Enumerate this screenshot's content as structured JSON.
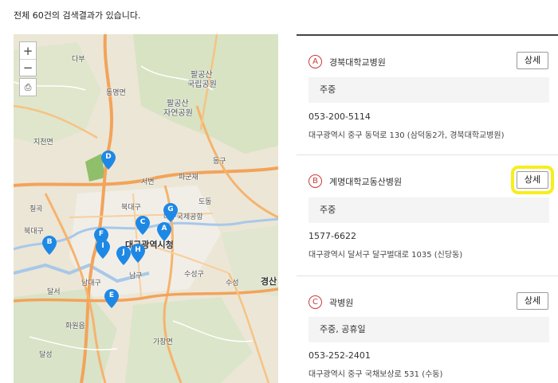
{
  "summary": "전체 60건의 검색결과가 있습니다.",
  "map": {
    "zoom_in": "+",
    "zoom_out": "−",
    "print_icon": "⎙",
    "places": [
      {
        "label": "팔공산",
        "cls": "mid"
      },
      {
        "label": "국립공원",
        "cls": "mid"
      },
      {
        "label": "팔공산",
        "cls": "mid"
      },
      {
        "label": "자연공원",
        "cls": "mid"
      },
      {
        "label": "다부",
        "cls": ""
      },
      {
        "label": "동명면",
        "cls": ""
      },
      {
        "label": "지천면",
        "cls": ""
      },
      {
        "label": "칠곡",
        "cls": ""
      },
      {
        "label": "서변",
        "cls": ""
      },
      {
        "label": "파군재",
        "cls": ""
      },
      {
        "label": "동구",
        "cls": ""
      },
      {
        "label": "도동",
        "cls": ""
      },
      {
        "label": "대구국제공항",
        "cls": ""
      },
      {
        "label": "북대구",
        "cls": ""
      },
      {
        "label": "대구광역시청",
        "cls": "big"
      },
      {
        "label": "남구",
        "cls": ""
      },
      {
        "label": "수성구",
        "cls": ""
      },
      {
        "label": "수성",
        "cls": ""
      },
      {
        "label": "달서",
        "cls": ""
      },
      {
        "label": "남대구",
        "cls": ""
      },
      {
        "label": "화원읍",
        "cls": ""
      },
      {
        "label": "가창면",
        "cls": ""
      },
      {
        "label": "달성",
        "cls": ""
      },
      {
        "label": "경산",
        "cls": "big"
      },
      {
        "label": "북대구",
        "cls": ""
      }
    ],
    "markers": [
      "A",
      "B",
      "C",
      "D",
      "E",
      "F",
      "G",
      "H",
      "I",
      "J"
    ],
    "marker_color": "#1e88e5"
  },
  "results": [
    {
      "letter": "A",
      "name": "경북대학교병원",
      "detail_label": "상세",
      "dept": "주중",
      "phone": "053-200-5114",
      "address": "대구광역시 중구 동덕로 130 (삼덕동2가, 경북대학교병원)"
    },
    {
      "letter": "B",
      "name": "계명대학교동산병원",
      "detail_label": "상세",
      "dept": "주중",
      "phone": "1577-6622",
      "address": "대구광역시 달서구 달구벌대로 1035 (신당동)"
    },
    {
      "letter": "C",
      "name": "곽병원",
      "detail_label": "상세",
      "dept": "주중, 공휴일",
      "phone": "053-252-2401",
      "address": "대구광역시 중구 국채보상로 531 (수동)"
    }
  ],
  "colors": {
    "highlight": "#f6ee1e",
    "letter_accent": "#c73a3a",
    "map_base": "#ece6d6"
  }
}
